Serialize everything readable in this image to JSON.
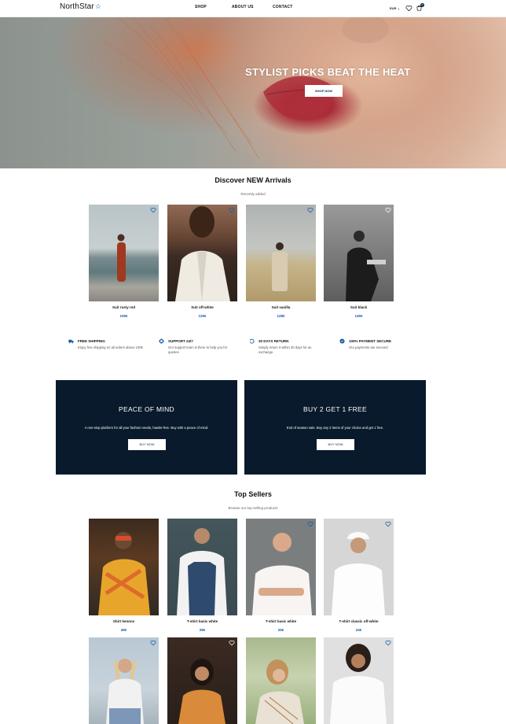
{
  "header": {
    "logo": "NorthStar",
    "logo_star": "☆",
    "nav": [
      "SHOP",
      "ABOUT US",
      "CONTACT"
    ],
    "currency": "EUR",
    "cart_count": "0"
  },
  "hero": {
    "title": "STYLIST PICKS BEAT THE HEAT",
    "button": "SHOP NOW"
  },
  "new_arrivals": {
    "title": "Discover NEW Arrivals",
    "subtitle": "Recently added",
    "products": [
      {
        "name": "Suit rusty red",
        "price": "105€"
      },
      {
        "name": "Suit off-white",
        "price": "125€"
      },
      {
        "name": "Suit vanilla",
        "price": "128€"
      },
      {
        "name": "Suit black",
        "price": "145€"
      }
    ]
  },
  "features": [
    {
      "icon": "truck-icon",
      "title": "FREE SHIPPING",
      "desc": "Enjoy free shipping on all orders above 100€"
    },
    {
      "icon": "lifebuoy-icon",
      "title": "SUPPORT 24/7",
      "desc": "Our support team is there to help you for queries"
    },
    {
      "icon": "return-icon",
      "title": "30 DAYS RETURN",
      "desc": "Simply return it within 30 days for an exchange."
    },
    {
      "icon": "secure-payment-icon",
      "title": "100% PAYMENT SECURE",
      "desc": "Our payments are secured"
    }
  ],
  "promos": [
    {
      "title": "PEACE OF MIND",
      "desc": "A one-stop platform for all your fashion needs, hassle-free. Buy with a peace of mind.",
      "button": "BUY NOW"
    },
    {
      "title": "BUY 2 GET 1 FREE",
      "desc": "End of season sale. Buy any 2 items of your choice and get 1 free.",
      "button": "BUY NOW"
    }
  ],
  "top_sellers": {
    "title": "Top Sellers",
    "subtitle": "Browse our top-selling products",
    "products": [
      {
        "name": "Shirt lemons",
        "price": "49€"
      },
      {
        "name": "T-shirt basic white",
        "price": "28€"
      },
      {
        "name": "T-shirt basic white",
        "price": "25€"
      },
      {
        "name": "T-shirt classic off-white",
        "price": "24€"
      }
    ]
  },
  "colors": {
    "accent": "#0b5aa6",
    "promo_bg": "#081a2b"
  }
}
